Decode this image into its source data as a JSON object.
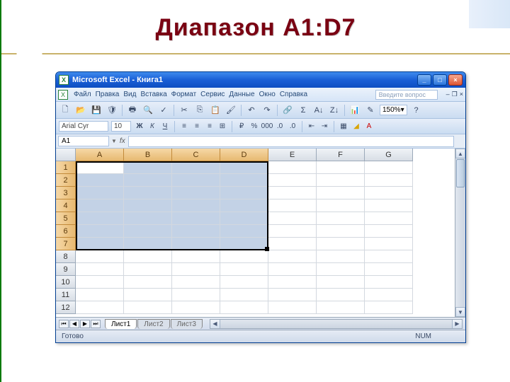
{
  "slide": {
    "title": "Диапазон A1:D7"
  },
  "window": {
    "title": "Microsoft Excel - Книга1"
  },
  "menu": {
    "items": [
      "Файл",
      "Правка",
      "Вид",
      "Вставка",
      "Формат",
      "Сервис",
      "Данные",
      "Окно",
      "Справка"
    ],
    "question_placeholder": "Введите вопрос"
  },
  "toolbar": {
    "zoom": "150%",
    "icons": [
      "new",
      "open",
      "save",
      "perm",
      "print",
      "preview",
      "spell",
      "cut",
      "copy",
      "paste",
      "fmtpaint",
      "undo",
      "redo",
      "link",
      "sum",
      "sort-asc",
      "sort-desc",
      "chart",
      "drawing",
      "zoom",
      "help"
    ]
  },
  "format": {
    "font_name": "Arial Cyr",
    "font_size": "10",
    "bold": "Ж",
    "italic": "К",
    "underline": "Ч"
  },
  "formula": {
    "name_box": "A1",
    "fx": "fx"
  },
  "grid": {
    "columns": [
      "A",
      "B",
      "C",
      "D",
      "E",
      "F",
      "G"
    ],
    "rows": [
      "1",
      "2",
      "3",
      "4",
      "5",
      "6",
      "7",
      "8",
      "9",
      "10",
      "11",
      "12"
    ],
    "selected_cols": [
      "A",
      "B",
      "C",
      "D"
    ],
    "selected_rows": [
      "1",
      "2",
      "3",
      "4",
      "5",
      "6",
      "7"
    ],
    "active_cell": "A1"
  },
  "tabs": {
    "sheets": [
      "Лист1",
      "Лист2",
      "Лист3"
    ],
    "active": 0
  },
  "status": {
    "ready": "Готово",
    "num": "NUM"
  }
}
